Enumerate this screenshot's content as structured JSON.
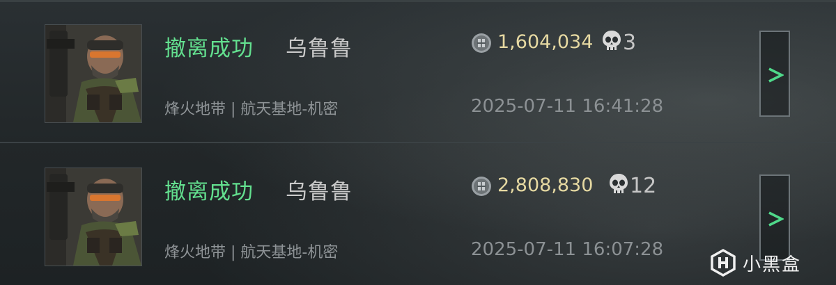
{
  "records": [
    {
      "status": "撤离成功",
      "player": "乌鲁鲁",
      "map": "烽火地带 | 航天基地-机密",
      "value": "1,604,034",
      "kills": "3",
      "datetime": "2025-07-11 16:41:28",
      "detail_label": ">"
    },
    {
      "status": "撤离成功",
      "player": "乌鲁鲁",
      "map": "烽火地带 | 航天基地-机密",
      "value": "2,808,830",
      "kills": "12",
      "datetime": "2025-07-11 16:07:28",
      "detail_label": ">"
    }
  ],
  "watermark": {
    "text": "小黑盒"
  },
  "colors": {
    "status_green": "#63e08f",
    "value_gold": "#e6d9a2",
    "arrow_green": "#4fd98a"
  },
  "icons": {
    "currency": "coin-icon",
    "kills": "skull-icon",
    "detail": "chevron-right-icon",
    "watermark_logo": "heybox-logo-icon"
  }
}
